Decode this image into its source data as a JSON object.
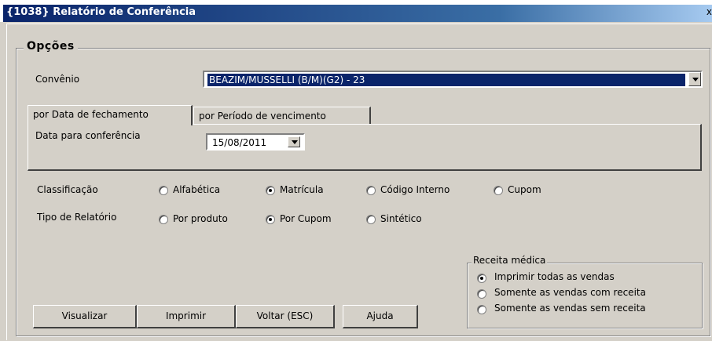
{
  "window": {
    "title": "{1038} Relatório de Conferência",
    "close_glyph": "x"
  },
  "group": {
    "legend": "Opções"
  },
  "convenio": {
    "label": "Convênio",
    "value": "BEAZIM/MUSSELLI (B/M)(G2) - 23"
  },
  "tabs": [
    {
      "label": "por Data de fechamento",
      "active": true
    },
    {
      "label": "por Período de vencimento",
      "active": false
    }
  ],
  "data_conferencia": {
    "label": "Data para conferência",
    "value": "15/08/2011"
  },
  "classificacao": {
    "label": "Classificação",
    "options": [
      {
        "label": "Alfabética",
        "checked": false
      },
      {
        "label": "Matrícula",
        "checked": true
      },
      {
        "label": "Código Interno",
        "checked": false
      },
      {
        "label": "Cupom",
        "checked": false
      }
    ]
  },
  "tipo_relatorio": {
    "label": "Tipo de Relatório",
    "options": [
      {
        "label": "Por produto",
        "checked": false
      },
      {
        "label": "Por Cupom",
        "checked": true
      },
      {
        "label": "Sintético",
        "checked": false
      }
    ]
  },
  "buttons": {
    "visualizar": "Visualizar",
    "imprimir": "Imprimir",
    "voltar": "Voltar (ESC)",
    "ajuda": "Ajuda"
  },
  "receita": {
    "legend": "Receita médica",
    "options": [
      {
        "label": "Imprimir todas as vendas",
        "checked": true
      },
      {
        "label": "Somente as vendas com receita",
        "checked": false
      },
      {
        "label": "Somente as vendas sem receita",
        "checked": false
      }
    ]
  }
}
